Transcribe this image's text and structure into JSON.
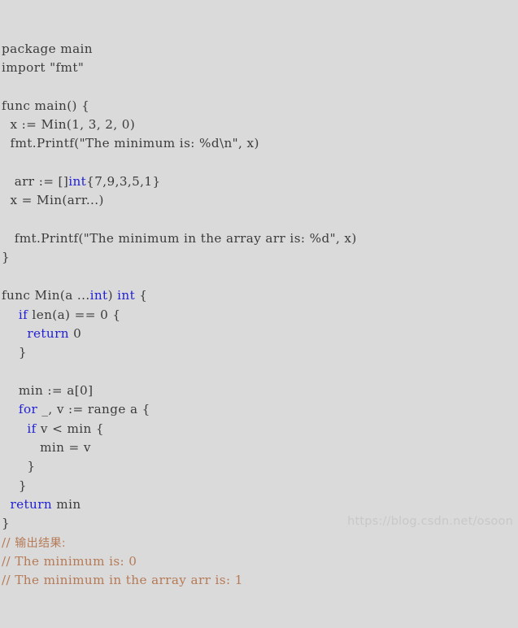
{
  "editor": {
    "language": "go",
    "background_color": "#dadada",
    "text_color": "#3b3b3b",
    "keyword_color": "#1f1fd4",
    "comment_color": "#b57a56",
    "watermark_color": "#c8c8c8"
  },
  "watermark": {
    "text": "https://blog.csdn.net/osoon"
  },
  "lines": [
    {
      "id": 1,
      "indent": "",
      "tokens": [
        {
          "t": "package main",
          "k": "plain"
        }
      ]
    },
    {
      "id": 2,
      "indent": "",
      "tokens": [
        {
          "t": "import \"fmt\"",
          "k": "plain"
        }
      ]
    },
    {
      "id": 3,
      "indent": "",
      "tokens": [
        {
          "t": "",
          "k": "plain"
        }
      ]
    },
    {
      "id": 4,
      "indent": "",
      "tokens": [
        {
          "t": "func main() {",
          "k": "plain"
        }
      ]
    },
    {
      "id": 5,
      "indent": "  ",
      "tokens": [
        {
          "t": "x := Min(1, 3, 2, 0)",
          "k": "plain"
        }
      ]
    },
    {
      "id": 6,
      "indent": "  ",
      "tokens": [
        {
          "t": "fmt.Printf(\"The minimum is: %d\\n\", x)",
          "k": "plain"
        }
      ]
    },
    {
      "id": 7,
      "indent": "",
      "tokens": [
        {
          "t": "",
          "k": "plain"
        }
      ]
    },
    {
      "id": 8,
      "indent": "   ",
      "tokens": [
        {
          "t": "arr := []",
          "k": "plain"
        },
        {
          "t": "int",
          "k": "kw"
        },
        {
          "t": "{7,9,3,5,1}",
          "k": "plain"
        }
      ]
    },
    {
      "id": 9,
      "indent": "  ",
      "tokens": [
        {
          "t": "x = Min(arr...)",
          "k": "plain"
        }
      ]
    },
    {
      "id": 10,
      "indent": "",
      "tokens": [
        {
          "t": "",
          "k": "plain"
        }
      ]
    },
    {
      "id": 11,
      "indent": "   ",
      "tokens": [
        {
          "t": "fmt.Printf(\"The minimum in the array arr is: %d\", x)",
          "k": "plain"
        }
      ]
    },
    {
      "id": 12,
      "indent": "",
      "tokens": [
        {
          "t": "}",
          "k": "plain"
        }
      ]
    },
    {
      "id": 13,
      "indent": "",
      "tokens": [
        {
          "t": "",
          "k": "plain"
        }
      ]
    },
    {
      "id": 14,
      "indent": "",
      "tokens": [
        {
          "t": "func Min(a ...",
          "k": "plain"
        },
        {
          "t": "int",
          "k": "kw"
        },
        {
          "t": ") ",
          "k": "plain"
        },
        {
          "t": "int",
          "k": "kw"
        },
        {
          "t": " {",
          "k": "plain"
        }
      ]
    },
    {
      "id": 15,
      "indent": "    ",
      "tokens": [
        {
          "t": "if",
          "k": "kw"
        },
        {
          "t": " len(a) == 0 {",
          "k": "plain"
        }
      ]
    },
    {
      "id": 16,
      "indent": "      ",
      "tokens": [
        {
          "t": "return",
          "k": "kw"
        },
        {
          "t": " 0",
          "k": "plain"
        }
      ]
    },
    {
      "id": 17,
      "indent": "    ",
      "tokens": [
        {
          "t": "}",
          "k": "plain"
        }
      ]
    },
    {
      "id": 18,
      "indent": "",
      "tokens": [
        {
          "t": "",
          "k": "plain"
        }
      ]
    },
    {
      "id": 19,
      "indent": "    ",
      "tokens": [
        {
          "t": "min := a[0]",
          "k": "plain"
        }
      ]
    },
    {
      "id": 20,
      "indent": "    ",
      "tokens": [
        {
          "t": "for",
          "k": "kw"
        },
        {
          "t": " _, v := range a {",
          "k": "plain"
        }
      ]
    },
    {
      "id": 21,
      "indent": "      ",
      "tokens": [
        {
          "t": "if",
          "k": "kw"
        },
        {
          "t": " v < min {",
          "k": "plain"
        }
      ]
    },
    {
      "id": 22,
      "indent": "         ",
      "tokens": [
        {
          "t": "min = v",
          "k": "plain"
        }
      ]
    },
    {
      "id": 23,
      "indent": "      ",
      "tokens": [
        {
          "t": "}",
          "k": "plain"
        }
      ]
    },
    {
      "id": 24,
      "indent": "    ",
      "tokens": [
        {
          "t": "}",
          "k": "plain"
        }
      ]
    },
    {
      "id": 25,
      "indent": "  ",
      "tokens": [
        {
          "t": "return",
          "k": "kw"
        },
        {
          "t": " min",
          "k": "plain"
        }
      ]
    },
    {
      "id": 26,
      "indent": "",
      "tokens": [
        {
          "t": "}",
          "k": "plain"
        }
      ]
    },
    {
      "id": 27,
      "indent": "",
      "tokens": [
        {
          "t": "// ",
          "k": "cmt"
        },
        {
          "t": "输出结果:",
          "k": "cmt-cjk"
        }
      ]
    },
    {
      "id": 28,
      "indent": "",
      "tokens": [
        {
          "t": "// The minimum is: 0",
          "k": "cmt"
        }
      ]
    },
    {
      "id": 29,
      "indent": "",
      "tokens": [
        {
          "t": "// The minimum in the array arr is: 1",
          "k": "cmt"
        }
      ]
    }
  ]
}
